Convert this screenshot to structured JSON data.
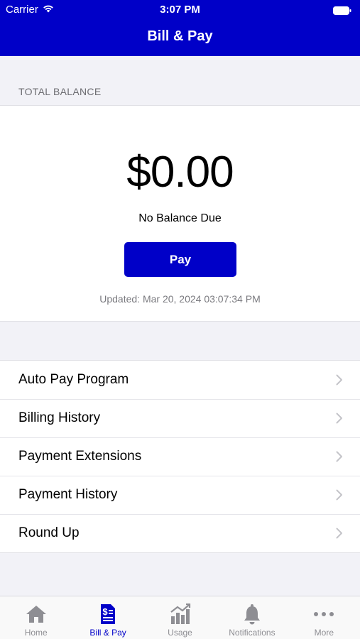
{
  "status_bar": {
    "carrier": "Carrier",
    "time": "3:07 PM"
  },
  "header": {
    "title": "Bill & Pay",
    "background_color": "#0000c8"
  },
  "balance": {
    "section_label": "TOTAL BALANCE",
    "amount": "$0.00",
    "status": "No Balance Due",
    "pay_label": "Pay",
    "updated": "Updated: Mar 20, 2024 03:07:34 PM"
  },
  "menu": {
    "items": [
      {
        "label": "Auto Pay Program",
        "icon": "chevron-right-icon"
      },
      {
        "label": "Billing History",
        "icon": "chevron-right-icon"
      },
      {
        "label": "Payment Extensions",
        "icon": "chevron-right-icon"
      },
      {
        "label": "Payment History",
        "icon": "chevron-right-icon"
      },
      {
        "label": "Round Up",
        "icon": "chevron-right-icon"
      }
    ]
  },
  "tab_bar": {
    "active_color": "#0000c8",
    "inactive_color": "#8e8e93",
    "tabs": [
      {
        "label": "Home",
        "icon": "home-icon",
        "active": false
      },
      {
        "label": "Bill & Pay",
        "icon": "bill-icon",
        "active": true
      },
      {
        "label": "Usage",
        "icon": "usage-chart-icon",
        "active": false
      },
      {
        "label": "Notifications",
        "icon": "bell-icon",
        "active": false
      },
      {
        "label": "More",
        "icon": "more-icon",
        "active": false
      }
    ]
  }
}
